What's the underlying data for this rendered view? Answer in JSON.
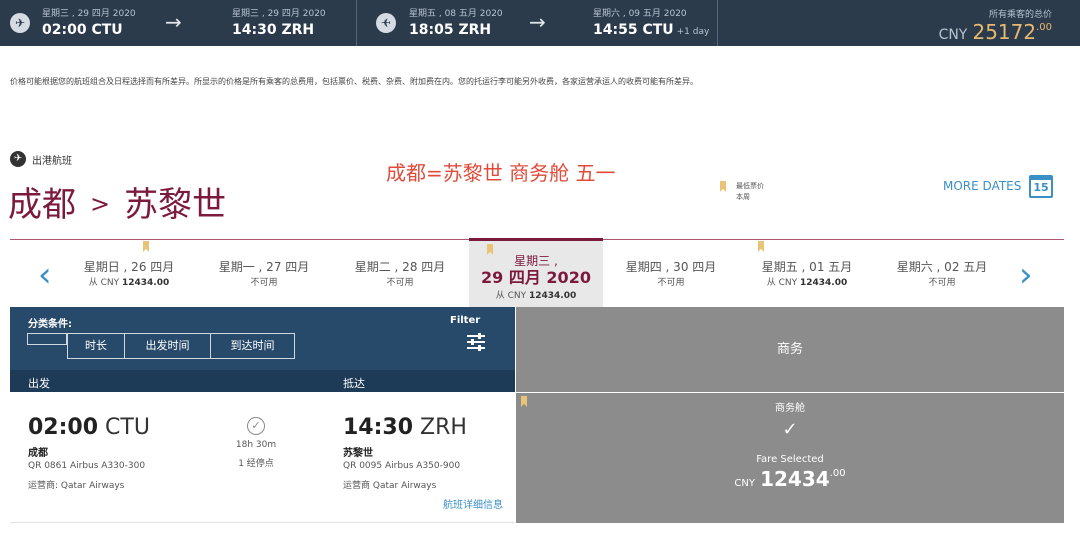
{
  "trip_summary": {
    "outbound": {
      "dep_date": "星期三 , 29 四月 2020",
      "dep_time": "02:00 CTU",
      "arr_date": "星期三 , 29 四月 2020",
      "arr_time": "14:30 ZRH"
    },
    "return": {
      "dep_date": "星期五 , 08 五月 2020",
      "dep_time": "18:05 ZRH",
      "arr_date": "星期六 , 09 五月 2020",
      "arr_time": "14:55 CTU",
      "arr_extra": "+1 day"
    },
    "total_label": "所有乘客的总价",
    "total_currency": "CNY",
    "total_amount": "25172",
    "total_decimal": ".00"
  },
  "notice": "价格可能根据您的航班组合及日程选择而有所差异。所显示的价格是所有乘客的总费用，包括票价、税费、杂费、附加费在内。您的托运行李可能另外收费，各家运营承运人的收费可能有所差异。",
  "route": {
    "outbound_label": "出港航班",
    "origin": "成都",
    "separator": ">",
    "destination": "苏黎世",
    "annotation": "成都=苏黎世 商务舱 五一",
    "lowest_fare_line1": "最低票价",
    "lowest_fare_line2": "本周",
    "more_dates": "MORE DATES",
    "calendar_day": "15"
  },
  "dates": [
    {
      "day": "星期日 , 26 四月",
      "price": "从 CNY ",
      "price_bold": "12434.00",
      "lowest": true
    },
    {
      "day": "星期一 , 27 四月",
      "price": "不可用",
      "price_bold": "",
      "lowest": false
    },
    {
      "day": "星期二 , 28 四月",
      "price": "不可用",
      "price_bold": "",
      "lowest": false
    },
    {
      "day_line1": "星期三 ,",
      "day_line2": "29 四月 2020",
      "price": "从 CNY ",
      "price_bold": "12434.00",
      "lowest": true,
      "selected": true
    },
    {
      "day": "星期四 , 30 四月",
      "price": "不可用",
      "price_bold": "",
      "lowest": false
    },
    {
      "day": "星期五 , 01 五月",
      "price": "从 CNY ",
      "price_bold": "12434.00",
      "lowest": true
    },
    {
      "day": "星期六 , 02 五月",
      "price": "不可用",
      "price_bold": "",
      "lowest": false
    }
  ],
  "filters": {
    "sort_label": "分类条件:",
    "sort_duration": "时长",
    "sort_departure": "出发时间",
    "sort_arrival": "到达时间",
    "filter_label": "Filter",
    "col_departure": "出发",
    "col_arrival": "抵达"
  },
  "cabin_header": "商务",
  "flight": {
    "dep_time": "02:00",
    "dep_code": "CTU",
    "dep_city": "成都",
    "dep_flight": "QR 0861 Airbus A330-300",
    "dep_operator": "运营商: Qatar Airways",
    "duration": "18h 30m",
    "stops": "1 经停点",
    "arr_time": "14:30",
    "arr_code": "ZRH",
    "arr_city": "苏黎世",
    "arr_flight": "QR 0095 Airbus A350-900",
    "arr_operator": "运营商 Qatar Airways",
    "details_link": "航班详细信息"
  },
  "fare": {
    "cabin_name": "商务舱",
    "status": "Fare Selected",
    "currency": "CNY",
    "amount": "12434",
    "decimal": ".00"
  },
  "colors": {
    "top_bar": "#2b3b4c",
    "accent_burgundy": "#7c1a3d",
    "link_blue": "#3a8fc7",
    "filter_panel": "#284a6a",
    "fare_grey": "#8c8c8c",
    "gold": "#e6b870",
    "annotation_red": "#e04b3a"
  }
}
